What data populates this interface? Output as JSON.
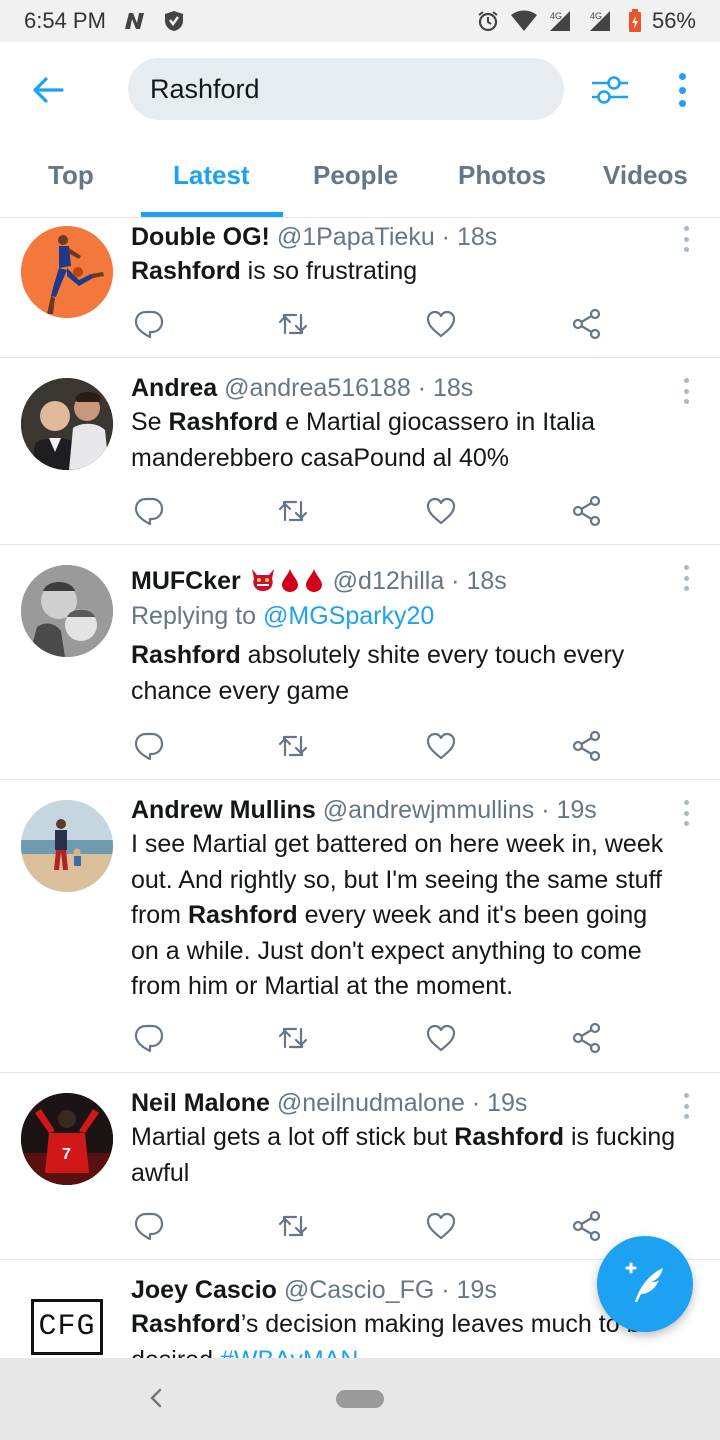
{
  "status_bar": {
    "time": "6:54 PM",
    "network_label": "4G",
    "battery": "56%"
  },
  "header": {
    "search_value": "Rashford"
  },
  "tabs": [
    {
      "label": "Top",
      "active": false
    },
    {
      "label": "Latest",
      "active": true
    },
    {
      "label": "People",
      "active": false
    },
    {
      "label": "Photos",
      "active": false
    },
    {
      "label": "Videos",
      "active": false
    }
  ],
  "tweets": [
    {
      "name": "Double OG!",
      "handle": "@1PapaTieku",
      "time": "18s",
      "text_bold": "Rashford",
      "text_rest": " is so frustrating"
    },
    {
      "name": "Andrea",
      "handle": "@andrea516188",
      "time": "18s",
      "text_pre": "Se ",
      "text_bold": "Rashford",
      "text_rest": " e Martial giocassero in Italia manderebbero casaPound al 40%"
    },
    {
      "name": "MUFCker",
      "name_emoji": "👹🩸🩸",
      "handle": "@d12hilla",
      "time": "18s",
      "replying_prefix": "Replying to ",
      "replying_to": "@MGSparky20",
      "text_bold": "Rashford",
      "text_rest": " absolutely shite every touch every chance every game"
    },
    {
      "name": "Andrew Mullins",
      "handle": "@andrewjmmullins",
      "time": "19s",
      "text_pre": "I see Martial get battered on here week in, week out. And rightly so, but I'm seeing the same stuff from ",
      "text_bold": "Rashford",
      "text_rest": " every week and it's been going on a while. Just don't expect anything to come from him or Martial at the moment."
    },
    {
      "name": "Neil Malone",
      "handle": "@neilnudmalone",
      "time": "19s",
      "text_pre": "Martial gets a lot off stick but ",
      "text_bold": "Rashford",
      "text_rest": " is fucking awful"
    },
    {
      "name": "Joey Cascio",
      "handle": "@Cascio_FG",
      "time": "19s",
      "text_bold": "Rashford",
      "text_rest": "’s decision making leaves much to be desired ",
      "hashtag": "#WBAvMAN",
      "avatar_text": "CFG"
    }
  ],
  "colors": {
    "accent": "#1da1f2",
    "text": "#14171a",
    "muted": "#657786",
    "divider": "#e1e8ed"
  },
  "icons": {
    "back": "arrow-left-icon",
    "filter": "sliders-icon",
    "more": "vertical-dots-icon",
    "reply": "speech-bubble-icon",
    "retweet": "retweet-icon",
    "like": "heart-icon",
    "share": "share-icon",
    "compose": "feather-plus-icon"
  }
}
